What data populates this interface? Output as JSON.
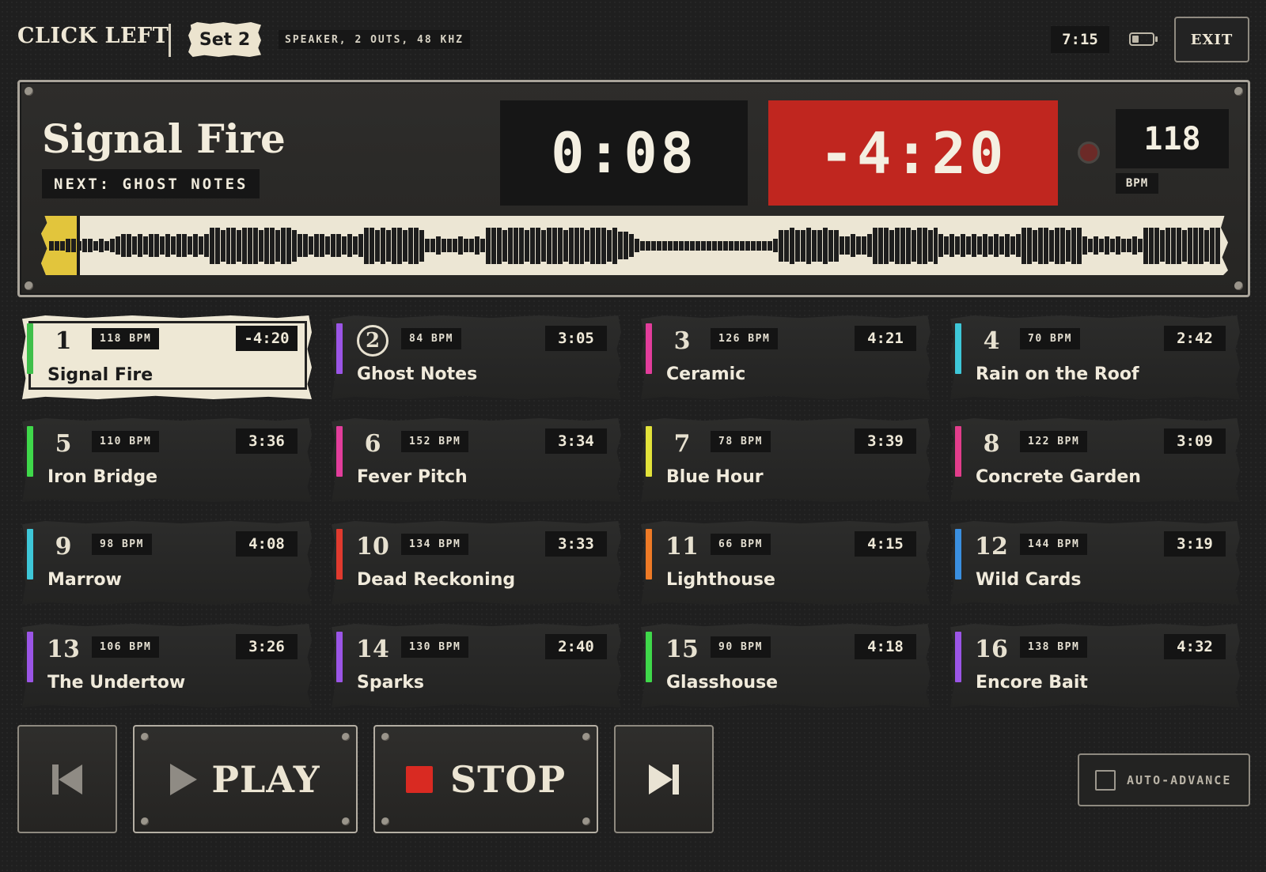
{
  "header": {
    "brand": "CLICK LEFT",
    "set_label": "Set 2",
    "device_info": "SPEAKER, 2 OUTS, 48 KHZ",
    "clock": "7:15",
    "battery_level": 0.35,
    "exit_label": "EXIT"
  },
  "now_playing": {
    "title": "Signal Fire",
    "next_label": "NEXT: GHOST NOTES",
    "elapsed": "0:08",
    "remaining": "-4:20",
    "bpm": "118",
    "bpm_label": "BPM",
    "progress": 0.03
  },
  "waveform": [
    2,
    2,
    2,
    3,
    3,
    2,
    3,
    3,
    2,
    3,
    2,
    3,
    4,
    5,
    5,
    4,
    5,
    4,
    5,
    5,
    4,
    5,
    4,
    5,
    5,
    4,
    5,
    4,
    5,
    8,
    8,
    7,
    8,
    8,
    7,
    8,
    8,
    8,
    7,
    8,
    8,
    7,
    8,
    8,
    7,
    5,
    5,
    4,
    5,
    5,
    4,
    5,
    5,
    4,
    5,
    4,
    5,
    8,
    8,
    7,
    8,
    7,
    8,
    8,
    7,
    8,
    8,
    7,
    3,
    3,
    4,
    3,
    3,
    3,
    4,
    3,
    3,
    4,
    3,
    8,
    8,
    8,
    7,
    8,
    8,
    8,
    7,
    8,
    8,
    7,
    8,
    8,
    8,
    7,
    8,
    8,
    8,
    7,
    8,
    8,
    8,
    7,
    8,
    6,
    6,
    5,
    3,
    2,
    2,
    2,
    2,
    2,
    2,
    2,
    2,
    2,
    2,
    2,
    2,
    2,
    2,
    2,
    2,
    2,
    2,
    2,
    2,
    2,
    2,
    2,
    2,
    3,
    7,
    7,
    8,
    7,
    7,
    8,
    7,
    7,
    8,
    7,
    7,
    4,
    4,
    5,
    4,
    4,
    5,
    8,
    8,
    8,
    7,
    8,
    8,
    8,
    7,
    8,
    8,
    7,
    8,
    5,
    4,
    5,
    4,
    5,
    4,
    5,
    4,
    5,
    4,
    5,
    4,
    5,
    4,
    5,
    8,
    8,
    7,
    8,
    8,
    7,
    8,
    8,
    7,
    8,
    8,
    4,
    3,
    4,
    3,
    4,
    3,
    4,
    3,
    3,
    4,
    3,
    8,
    8,
    8,
    7,
    8,
    8,
    8,
    7,
    8,
    8,
    8,
    7,
    8,
    8
  ],
  "tracks": [
    {
      "num": "1",
      "bpm": "118 BPM",
      "dur": "-4:20",
      "title": "Signal Fire",
      "color": "#3fbf4a",
      "active": true
    },
    {
      "num": "2",
      "bpm": "84 BPM",
      "dur": "3:05",
      "title": "Ghost Notes",
      "color": "#9b55e6",
      "circled": true
    },
    {
      "num": "3",
      "bpm": "126 BPM",
      "dur": "4:21",
      "title": "Ceramic",
      "color": "#e23d9b"
    },
    {
      "num": "4",
      "bpm": "70 BPM",
      "dur": "2:42",
      "title": "Rain on the Roof",
      "color": "#3ec7d8"
    },
    {
      "num": "5",
      "bpm": "110 BPM",
      "dur": "3:36",
      "title": "Iron Bridge",
      "color": "#3fd84a"
    },
    {
      "num": "6",
      "bpm": "152 BPM",
      "dur": "3:34",
      "title": "Fever Pitch",
      "color": "#e23d9b"
    },
    {
      "num": "7",
      "bpm": "78 BPM",
      "dur": "3:39",
      "title": "Blue Hour",
      "color": "#e2e23a"
    },
    {
      "num": "8",
      "bpm": "122 BPM",
      "dur": "3:09",
      "title": "Concrete Garden",
      "color": "#e23d8b"
    },
    {
      "num": "9",
      "bpm": "98 BPM",
      "dur": "4:08",
      "title": "Marrow",
      "color": "#3ec7d8"
    },
    {
      "num": "10",
      "bpm": "134 BPM",
      "dur": "3:33",
      "title": "Dead Reckoning",
      "color": "#e03a2e"
    },
    {
      "num": "11",
      "bpm": "66 BPM",
      "dur": "4:15",
      "title": "Lighthouse",
      "color": "#ee7a26"
    },
    {
      "num": "12",
      "bpm": "144 BPM",
      "dur": "3:19",
      "title": "Wild Cards",
      "color": "#3a8fe0"
    },
    {
      "num": "13",
      "bpm": "106 BPM",
      "dur": "3:26",
      "title": "The Undertow",
      "color": "#9b55e6"
    },
    {
      "num": "14",
      "bpm": "130 BPM",
      "dur": "2:40",
      "title": "Sparks",
      "color": "#9b55e6"
    },
    {
      "num": "15",
      "bpm": "90 BPM",
      "dur": "4:18",
      "title": "Glasshouse",
      "color": "#3fd84a"
    },
    {
      "num": "16",
      "bpm": "138 BPM",
      "dur": "4:32",
      "title": "Encore Bait",
      "color": "#9b55e6"
    }
  ],
  "transport": {
    "prev_icon": "skip-back-icon",
    "play_label": "PLAY",
    "play_icon": "play-icon",
    "stop_label": "STOP",
    "stop_icon": "stop-icon",
    "next_icon": "skip-forward-icon",
    "auto_advance_label": "AUTO-ADVANCE",
    "auto_advance_checked": false
  },
  "colors": {
    "accent_red": "#c0261f",
    "progress_yellow": "#e2c53c",
    "paper": "#ece6d4"
  }
}
